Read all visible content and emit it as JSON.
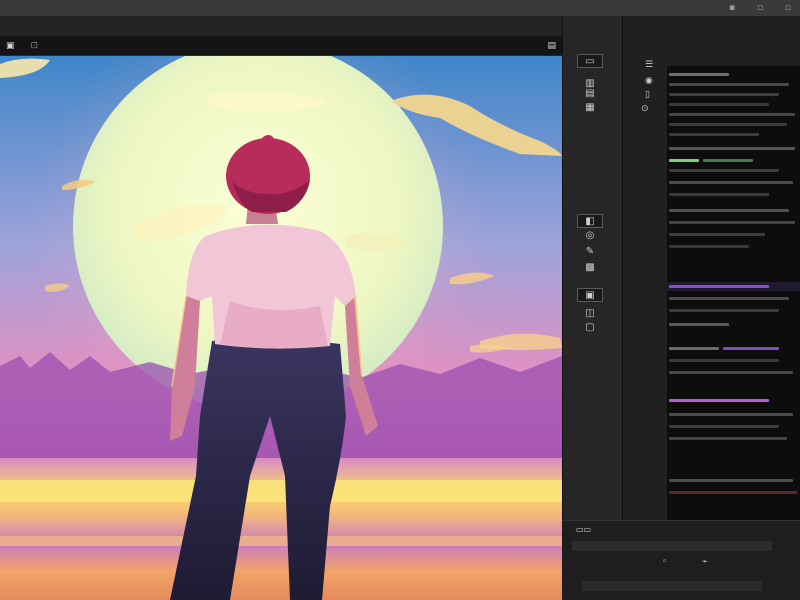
{
  "menu": {
    "items": [
      "",
      "",
      "",
      "",
      "",
      ""
    ]
  },
  "document": {
    "tab_label": "",
    "file_info": ""
  },
  "panel": {
    "title": "",
    "subtitle": ""
  },
  "colors": {
    "sky_top": "#3f86c9",
    "sky_mid": "#e58fc0",
    "moon": "#f2f7c7",
    "water": "#f7d56b",
    "panel_bg": "#202020",
    "layer_bg": "#0d0d0d",
    "highlight_purple": "#8a4de0",
    "green_text": "#7fcf7f"
  },
  "icons": {
    "doc": "document-icon",
    "zoom": "zoom-icon",
    "panel_toggle": "panel-toggle-icon",
    "minimize": "minimize-icon",
    "maximize": "maximize-icon",
    "close": "close-icon"
  }
}
